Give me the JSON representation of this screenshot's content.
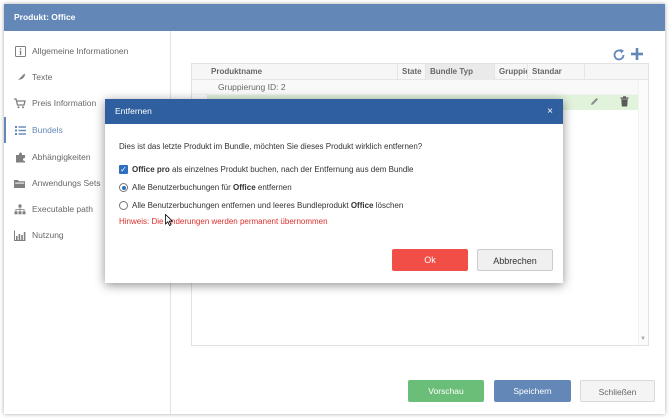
{
  "window": {
    "title": "Produkt: Office"
  },
  "sidebar": {
    "items": [
      {
        "label": "Allgemeine Informationen",
        "icon": "info-icon"
      },
      {
        "label": "Texte",
        "icon": "feather-icon"
      },
      {
        "label": "Preis Information",
        "icon": "cart-icon"
      },
      {
        "label": "Bundels",
        "icon": "list-icon",
        "active": true
      },
      {
        "label": "Abhängigkeiten",
        "icon": "puzzle-icon"
      },
      {
        "label": "Anwendungs Sets",
        "icon": "folder-icon"
      },
      {
        "label": "Executable path",
        "icon": "sitemap-icon"
      },
      {
        "label": "Nutzung",
        "icon": "chart-icon"
      }
    ]
  },
  "grid": {
    "columns": [
      "Produktname",
      "State",
      "Bundle Typ",
      "Gruppie",
      "Standar"
    ],
    "group_label": "Gruppierung ID: 2"
  },
  "footer": {
    "preview": "Vorschau",
    "save": "Speichern",
    "close": "Schließen"
  },
  "dialog": {
    "title": "Entfernen",
    "close": "×",
    "question": "Dies ist das letzte Produkt im Bundle, möchten Sie dieses Produkt wirklich entfernen?",
    "checkbox": {
      "bold": "Office pro",
      "rest": " als einzelnes Produkt buchen, nach der Entfernung aus dem Bundle",
      "checked": true
    },
    "option1": {
      "pre": "Alle Benutzerbuchungen für ",
      "bold": "Office",
      "post": " entfernen",
      "selected": true
    },
    "option2": {
      "pre": "Alle Benutzerbuchungen entfernen und leeres Bundleprodukt ",
      "bold": "Office",
      "post": " löschen",
      "selected": false
    },
    "hint": "Hinweis: Die Änderungen werden permanent übernommen",
    "ok": "Ok",
    "cancel": "Abbrechen"
  },
  "colors": {
    "primary": "#2f5f9e",
    "success": "#3aa84a",
    "danger": "#f04e47",
    "hint": "#d9302e",
    "selected_row": "#d9efd1"
  }
}
